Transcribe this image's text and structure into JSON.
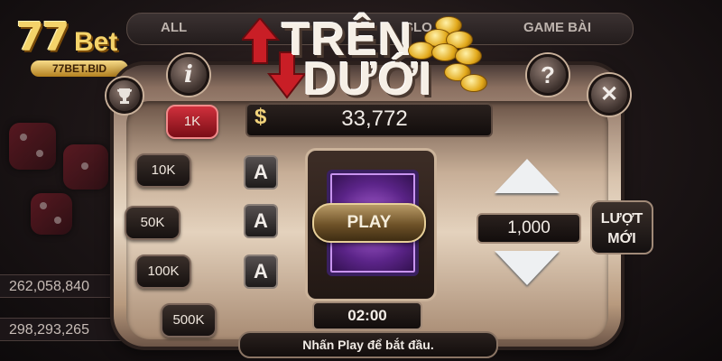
{
  "brand": {
    "logo_main": "77",
    "logo_suffix": "Bet",
    "domain": "77BET.BID"
  },
  "lobby": {
    "tabs": [
      {
        "label": "ALL"
      },
      {
        "label": "SLO"
      },
      {
        "label": "GAME BÀI"
      }
    ],
    "counters": [
      {
        "value": "262,058,840"
      },
      {
        "value": "298,293,265"
      }
    ]
  },
  "game": {
    "title_top": "TRÊN",
    "title_bottom": "DƯỚI",
    "balance_symbol": "$",
    "balance": "33,772",
    "chips": [
      {
        "label": "1K",
        "active": true
      },
      {
        "label": "10K",
        "active": false
      },
      {
        "label": "50K",
        "active": false
      },
      {
        "label": "100K",
        "active": false
      },
      {
        "label": "500K",
        "active": false
      }
    ],
    "card_slots": [
      {
        "label": "A"
      },
      {
        "label": "A"
      },
      {
        "label": "A"
      }
    ],
    "play_label": "PLAY",
    "timer": "02:00",
    "bet_value": "1,000",
    "skip_label_line1": "LƯỢT",
    "skip_label_line2": "MỚI",
    "status_text": "Nhấn Play để bắt đầu.",
    "close_symbol": "✕",
    "help_symbol": "?",
    "info_symbol": "i"
  },
  "colors": {
    "accent_gold": "#f4d36a",
    "active_chip": "#d0303c",
    "card_purple": "#5b2488"
  },
  "icons": [
    "trophy-icon",
    "info-icon",
    "help-icon",
    "close-icon",
    "up-arrow-icon",
    "down-arrow-icon",
    "coins-icon"
  ]
}
